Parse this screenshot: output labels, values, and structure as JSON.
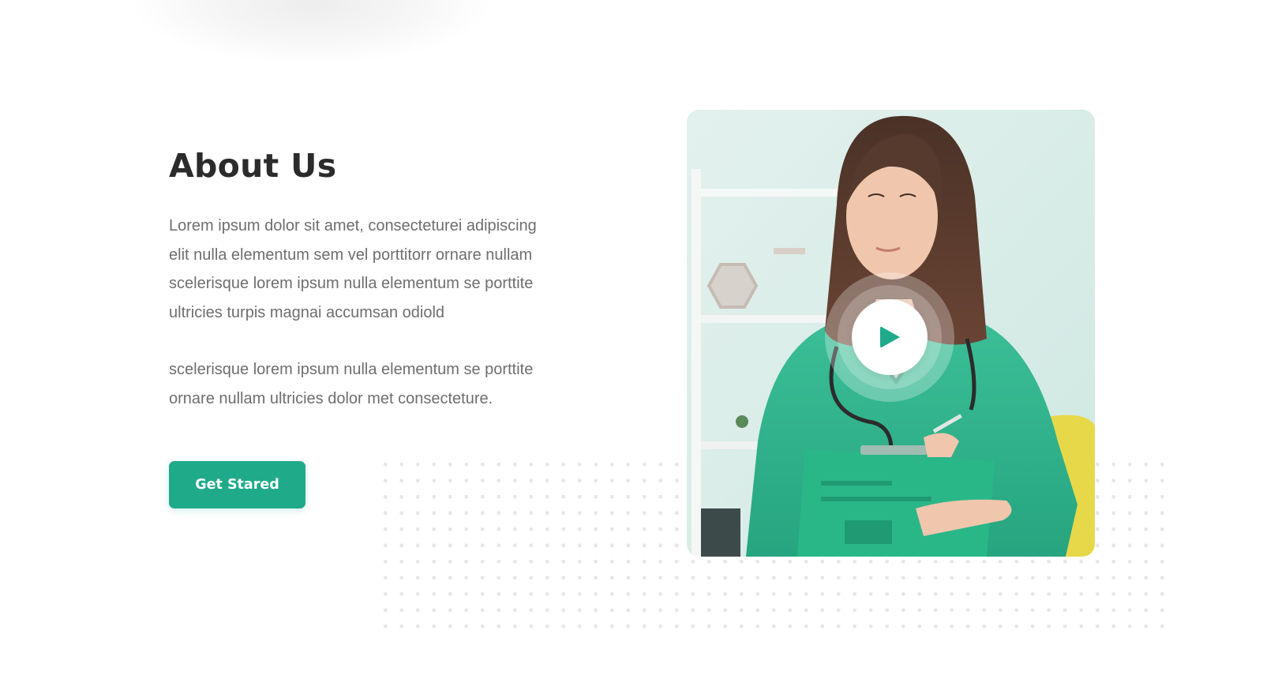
{
  "about": {
    "title": "About Us",
    "paragraph_1": "Lorem ipsum dolor sit amet, consecteturei adipiscing\nelit nulla elementum sem vel porttitorr ornare nullam\nscelerisque lorem ipsum nulla elementum se porttite\nultricies turpis magnai  accumsan odiold",
    "paragraph_2": "scelerisque lorem ipsum nulla elementum se porttite\nornare nullam ultricies dolor met consecteture.",
    "button_label": "Get Stared"
  },
  "media": {
    "image_subject": "nurse-in-green-scrubs-holding-clipboard",
    "play_icon": "play-icon"
  },
  "colors": {
    "accent": "#1faa89",
    "heading": "#2b2b2b",
    "body_text": "#6e6e6e",
    "background": "#ffffff"
  }
}
